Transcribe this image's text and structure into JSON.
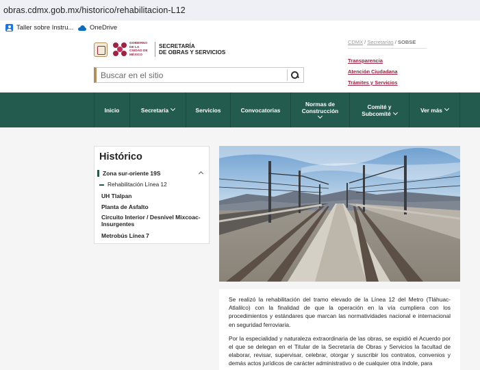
{
  "browser": {
    "url": "obras.cdmx.gob.mx/historico/rehabilitacion-L12",
    "bookmarks": [
      {
        "label": "Taller sobre Instru...",
        "icon": "person-icon"
      },
      {
        "label": "OneDrive",
        "icon": "cloud-icon"
      }
    ]
  },
  "header": {
    "gov_text": "GOBIERNO DE LA CIUDAD DE MÉXICO",
    "secretaria_line1": "SECRETARÍA",
    "secretaria_line2": "DE OBRAS Y SERVICIOS",
    "search_placeholder": "Buscar en el sitio",
    "breadcrumb": {
      "item1": "CDMX",
      "sep": " / ",
      "item2": "Secretarías",
      "item3": "SOBSE"
    },
    "util_links": [
      "Transparencia",
      "Atención Ciudadana",
      "Trámites y Servicios"
    ]
  },
  "nav": {
    "items": [
      {
        "label": "Inicio",
        "has_chevron": false
      },
      {
        "label": "Secretaría",
        "has_chevron": true
      },
      {
        "label": "Servicios",
        "has_chevron": false
      },
      {
        "label": "Convocatorias",
        "has_chevron": false
      },
      {
        "label_line1": "Normas de",
        "label_line2": "Construcción",
        "has_chevron": true
      },
      {
        "label_line1": "Comité y",
        "label_line2": "Subcomité",
        "has_chevron": true
      },
      {
        "label": "Ver más",
        "has_chevron": true
      }
    ]
  },
  "sidebar": {
    "title": "Histórico",
    "active_item": "Zona sur-oriente 19S",
    "sub_item": "Rehabilitación Línea 12",
    "items": [
      "UH Tlalpan",
      "Planta de Asfalto",
      "Circuito Interior / Desnivel Mixcoac-Insurgentes",
      "Metrobús Línea 7"
    ]
  },
  "article": {
    "paragraphs": [
      "Se realizó la rehabilitación del tramo elevado de la Línea 12 del Metro (Tláhuac-Atlalilco) con la finalidad de que la operación en la vía cumpliera con los procedimientos y estándares que marcan las normatividades nacional e internacional en seguridad ferroviaria.",
      "Por la especialidad y naturaleza extraordinaria de las obras, se expidió el Acuerdo por el que se delegan en el Titular de la Secretaría de Obras y Servicios la facultad de elaborar, revisar, supervisar, celebrar, otorgar y suscribir los contratos, convenios y demás actos jurídicos de carácter administrativo o de cualquier otra índole, para"
    ]
  },
  "colors": {
    "primary_green": "#235b4e",
    "accent_red": "#9f2241",
    "gold": "#b38e5d",
    "content_bg": "#f5f5f5"
  }
}
